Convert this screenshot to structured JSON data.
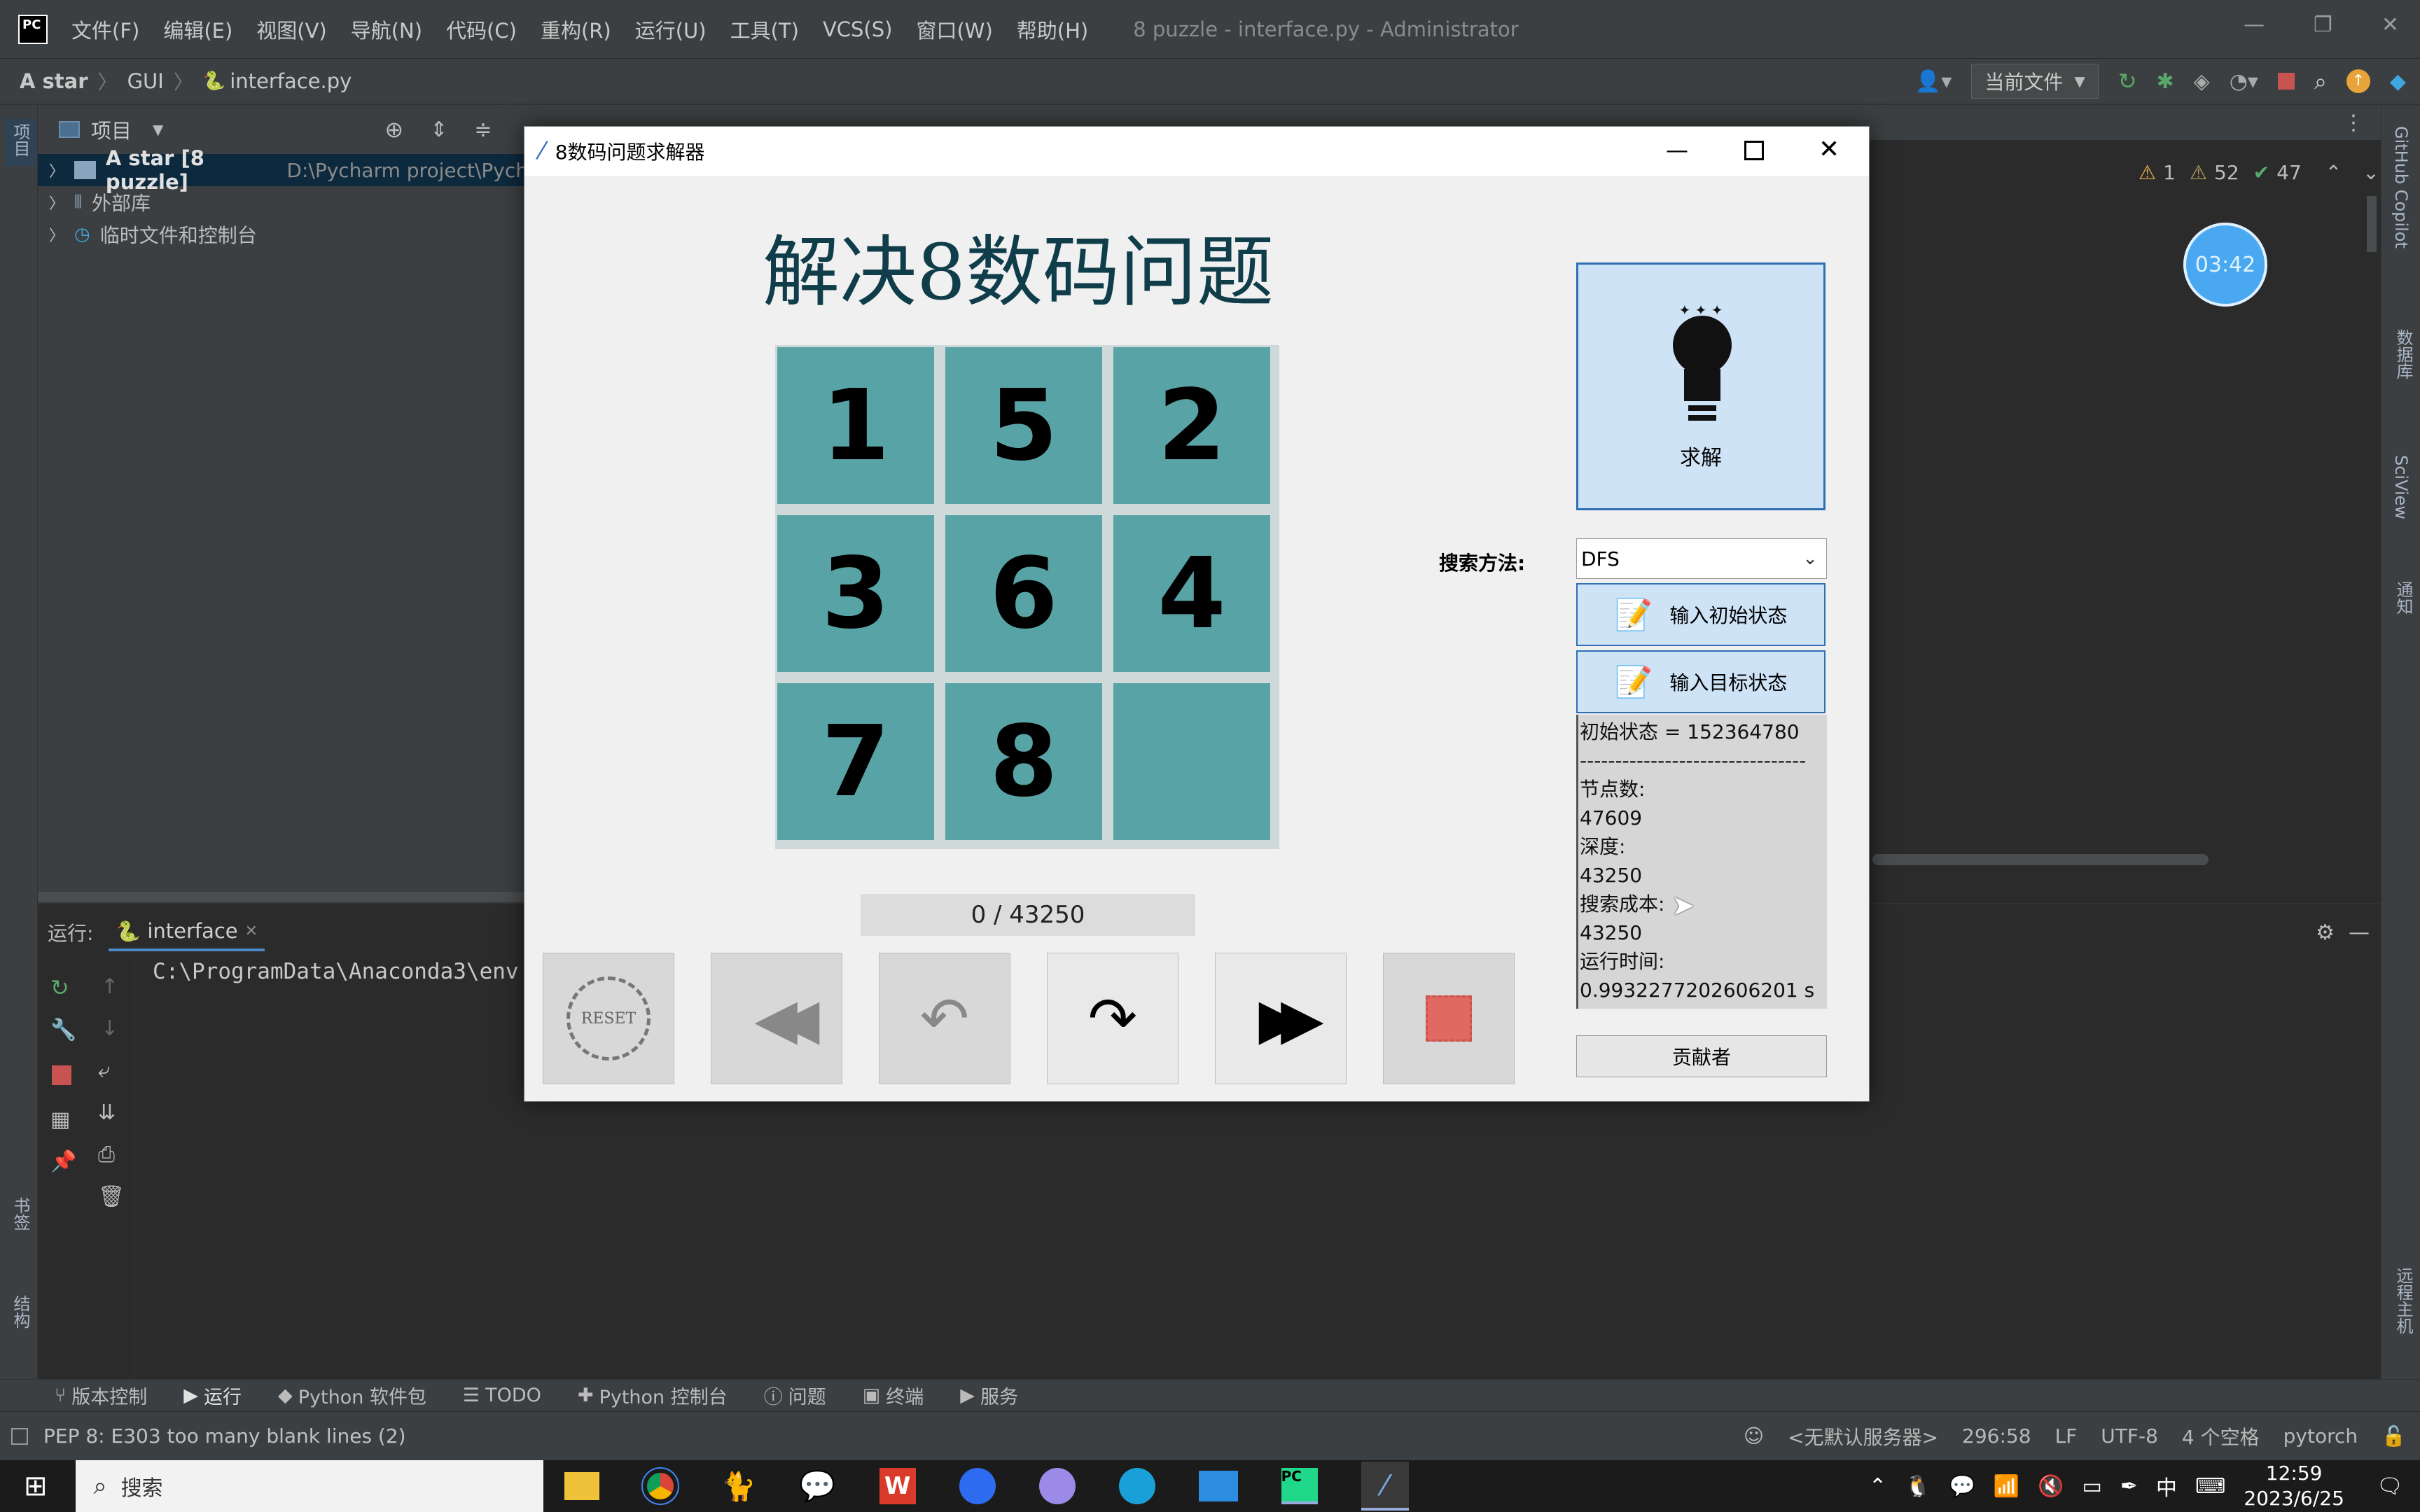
{
  "ide": {
    "logo": "PC",
    "menu": [
      "文件(F)",
      "编辑(E)",
      "视图(V)",
      "导航(N)",
      "代码(C)",
      "重构(R)",
      "运行(U)",
      "工具(T)",
      "VCS(S)",
      "窗口(W)",
      "帮助(H)"
    ],
    "window_title": "8 puzzle - interface.py - Administrator",
    "breadcrumb": [
      "A star",
      "GUI",
      "interface.py"
    ],
    "run_config": "当前文件",
    "project_label": "项目",
    "tree": [
      {
        "name": "A star [8 puzzle]",
        "path": "D:\\Pycharm project\\Pych"
      },
      {
        "name": "外部库"
      },
      {
        "name": "临时文件和控制台"
      }
    ],
    "inspections": {
      "warn1": "1",
      "warn2": "52",
      "ok": "47"
    },
    "timer": "03:42",
    "run_label": "运行:",
    "run_tab": "interface",
    "console_line": "C:\\ProgramData\\Anaconda3\\env",
    "left_tools": [
      "项目",
      "书签",
      "结构"
    ],
    "right_tools": [
      "GitHub Copilot",
      "数据库",
      "SciView",
      "通知",
      "远程主机"
    ],
    "bottom_tabs": [
      "版本控制",
      "运行",
      "Python 软件包",
      "TODO",
      "Python 控制台",
      "问题",
      "终端",
      "服务"
    ],
    "status_msg": "PEP 8: E303 too many blank lines (2)",
    "status_right": [
      "<无默认服务器>",
      "296:58",
      "LF",
      "UTF-8",
      "4 个空格",
      "pytorch"
    ]
  },
  "taskbar": {
    "search": "搜索",
    "time": "12:59",
    "date": "2023/6/25",
    "ime": "中"
  },
  "app": {
    "title": "8数码问题求解器",
    "heading": "解决8数码问题",
    "tiles": [
      "1",
      "5",
      "2",
      "3",
      "6",
      "4",
      "7",
      "8",
      ""
    ],
    "progress": "0 / 43250",
    "solve_label": "求解",
    "search_method_label": "搜索方法:",
    "search_method": "DFS",
    "input_initial": "输入初始状态",
    "input_target": "输入目标状态",
    "info": {
      "initial": "初始状态 = 152364780",
      "divider": "--------------------------------",
      "nodes_label": "节点数:",
      "nodes": "47609",
      "depth_label": "深度:",
      "depth": "43250",
      "cost_label": "搜索成本:",
      "cost": "43250",
      "time_label": "运行时间:",
      "time": "0.9932277202606201 s"
    },
    "contributors": "贡献者",
    "reset_text": "RESET"
  },
  "colors": {
    "tile": "#58a3a6",
    "solve_bg": "#cfe3f7",
    "heading": "#0f3d4a",
    "ide_bg": "#2b2b2b",
    "panel": "#3c3f41"
  }
}
